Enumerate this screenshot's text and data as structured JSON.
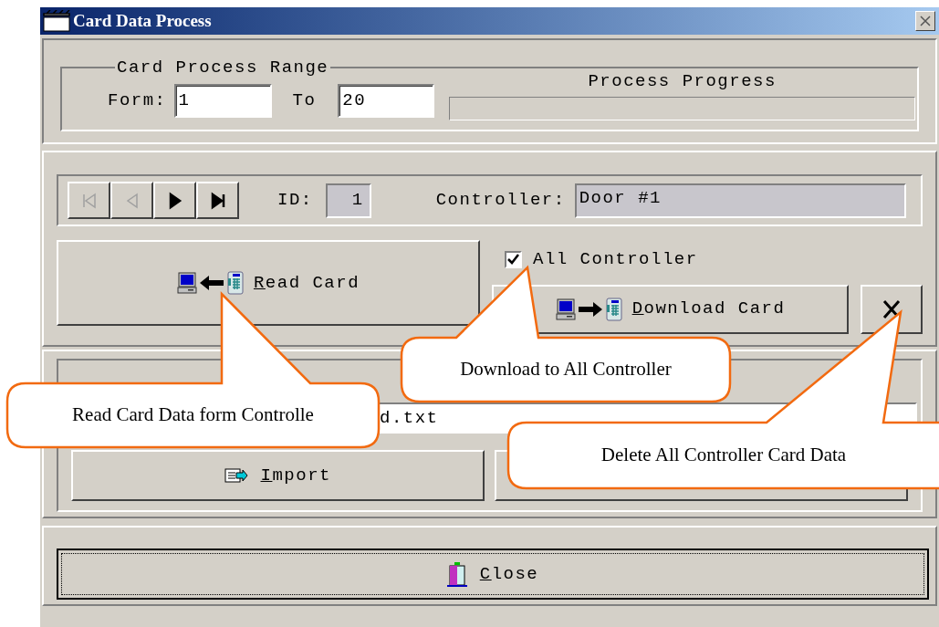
{
  "window": {
    "title": "Card Data Process"
  },
  "range": {
    "legend": "Card Process Range",
    "from_label": "Form:",
    "from_value": "1",
    "to_label": "To",
    "to_value": "20",
    "progress_label": "Process Progress",
    "progress": {
      "level": 0
    }
  },
  "navigator": {
    "buttons": [
      {
        "kind": "first",
        "disabled": true
      },
      {
        "kind": "prev",
        "disabled": true
      },
      {
        "kind": "next",
        "disabled": false
      },
      {
        "kind": "last",
        "disabled": false
      }
    ],
    "id_label": "ID:",
    "id_value": "1",
    "controller_label": "Controller:",
    "controller_value": "Door #1"
  },
  "read_button": {
    "label": "Read Card"
  },
  "all_controller": {
    "label": "All Controller",
    "checked": true
  },
  "download_button": {
    "label": "Download Card"
  },
  "file": {
    "value": "d.txt"
  },
  "import_button": {
    "label": "Import"
  },
  "close_button": {
    "label": "Close"
  },
  "callouts": [
    {
      "kind": "read",
      "text": "Read Card Data form Controlle"
    },
    {
      "kind": "download",
      "text": "Download to All Controller"
    },
    {
      "kind": "delete",
      "text": "Delete All Controller Card Data"
    }
  ]
}
